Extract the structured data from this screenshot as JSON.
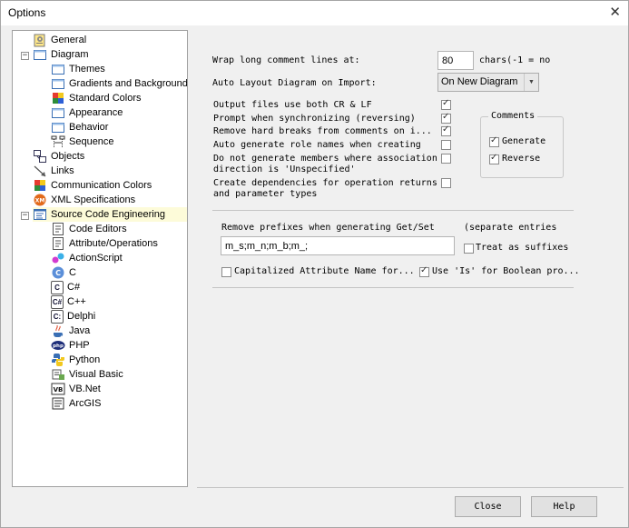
{
  "window": {
    "title": "Options"
  },
  "tree": [
    {
      "label": "General"
    },
    {
      "label": "Diagram"
    },
    {
      "label": "Themes"
    },
    {
      "label": "Gradients and Background"
    },
    {
      "label": "Standard Colors"
    },
    {
      "label": "Appearance"
    },
    {
      "label": "Behavior"
    },
    {
      "label": "Sequence"
    },
    {
      "label": "Objects"
    },
    {
      "label": "Links"
    },
    {
      "label": "Communication Colors"
    },
    {
      "label": "XML Specifications"
    },
    {
      "label": "Source Code Engineering"
    },
    {
      "label": "Code Editors"
    },
    {
      "label": "Attribute/Operations"
    },
    {
      "label": "ActionScript"
    },
    {
      "label": "C"
    },
    {
      "label": "C#"
    },
    {
      "label": "C++"
    },
    {
      "label": "Delphi"
    },
    {
      "label": "Java"
    },
    {
      "label": "PHP"
    },
    {
      "label": "Python"
    },
    {
      "label": "Visual Basic"
    },
    {
      "label": "VB.Net"
    },
    {
      "label": "ArcGIS"
    }
  ],
  "badges": {
    "c": "C",
    "cs": "C#",
    "cpp": "C++",
    "delphi": "C:"
  },
  "settings": {
    "wrap_label": "Wrap long comment lines at:",
    "wrap_value": "80",
    "wrap_suffix": "chars(-1 = no",
    "auto_layout_label": "Auto Layout Diagram on Import:",
    "auto_layout_value": "On New Diagram",
    "options": [
      {
        "label": "Output files use both CR & LF",
        "checked": true
      },
      {
        "label": "Prompt when synchronizing (reversing)",
        "checked": true
      },
      {
        "label": "Remove hard breaks from  comments on i...",
        "checked": true
      },
      {
        "label": "Auto generate role names when creating",
        "checked": false
      },
      {
        "label": "Do not generate members where association",
        "label2": "direction is 'Unspecified'",
        "checked": false
      },
      {
        "label": "Create dependencies for operation returns",
        "label2": "and parameter types",
        "checked": false
      }
    ],
    "comments": {
      "title": "Comments",
      "generate": {
        "label": "Generate",
        "checked": true
      },
      "reverse": {
        "label": "Reverse",
        "checked": true
      }
    },
    "prefixes": {
      "label": "Remove prefixes when generating Get/Set",
      "note": "(separate entries",
      "value": "m_s;m_n;m_b;m_;",
      "suffix": {
        "label": "Treat as suffixes",
        "checked": false
      }
    },
    "capitalized": {
      "label": "Capitalized Attribute Name for...",
      "checked": false
    },
    "use_is": {
      "label": "Use 'Is' for Boolean pro...",
      "checked": true
    }
  },
  "buttons": {
    "close": "Close",
    "help": "Help"
  },
  "colors": {
    "selected_bg": "#fdfbd9",
    "window_bg": "#f0f0f0"
  }
}
